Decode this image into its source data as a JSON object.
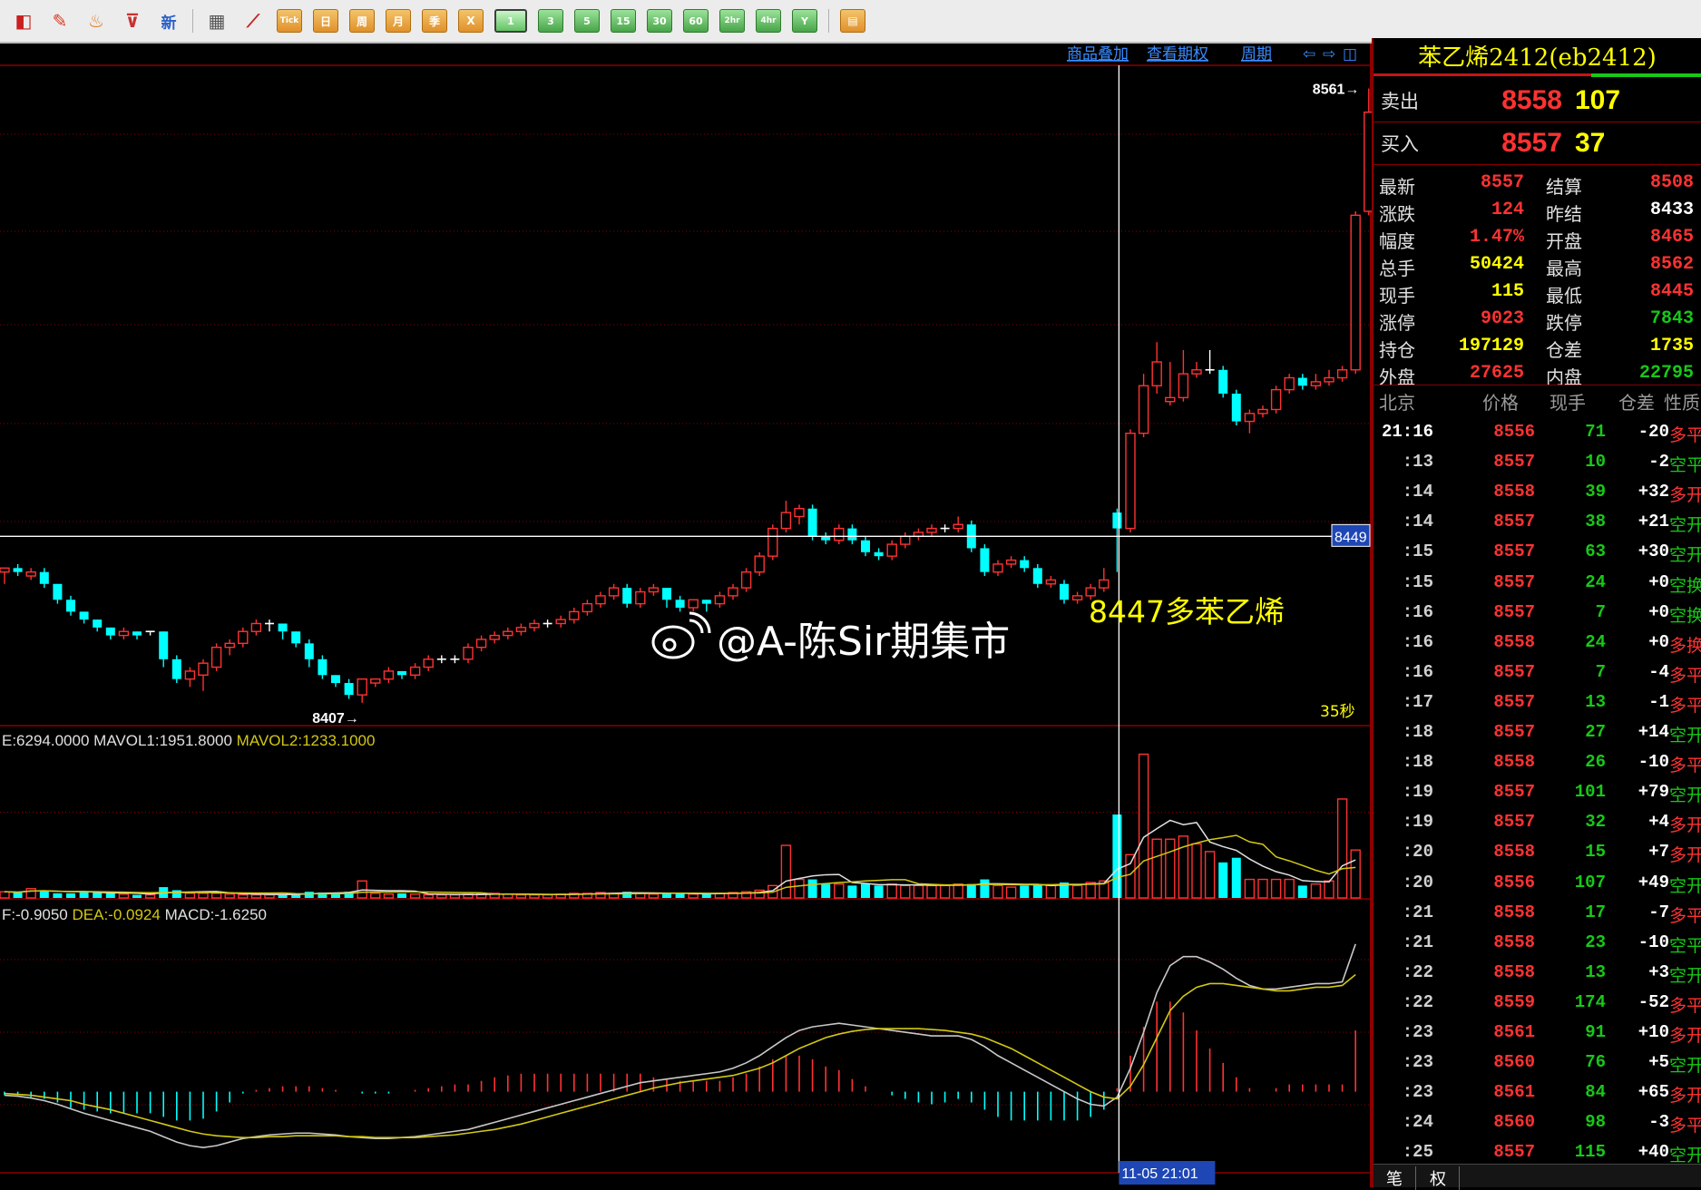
{
  "toolbar": {
    "icons": [
      "window-icon",
      "pencil-icon",
      "bell-icon",
      "filter-icon",
      "new-icon",
      "table-icon",
      "trend-icon"
    ],
    "new_label": "新",
    "periods": [
      "Tick",
      "日",
      "周",
      "月",
      "季",
      "X"
    ],
    "minutes": [
      "1",
      "3",
      "5",
      "15",
      "30",
      "60",
      "2hr",
      "4hr",
      "Y"
    ],
    "selected_minute": "1"
  },
  "chart_header": {
    "links": [
      "商品叠加",
      "查看期权",
      "周期"
    ]
  },
  "instrument": {
    "title": "苯乙烯2412(eb2412)",
    "sell_label": "卖出",
    "sell_price": "8558",
    "sell_vol": "107",
    "buy_label": "买入",
    "buy_price": "8557",
    "buy_vol": "37"
  },
  "stats": [
    {
      "l": "最新",
      "lv": "8557",
      "r": "结算",
      "rv": "8508",
      "rc": "#ff3232"
    },
    {
      "l": "涨跌",
      "lv": "124",
      "r": "昨结",
      "rv": "8433",
      "rc": "#ffffff"
    },
    {
      "l": "幅度",
      "lv": "1.47%",
      "r": "开盘",
      "rv": "8465",
      "rc": "#ff3232"
    },
    {
      "l": "总手",
      "lv": "50424",
      "r": "最高",
      "rv": "8562",
      "rc": "#ff3232",
      "lc": "#ffff00"
    },
    {
      "l": "现手",
      "lv": "115",
      "r": "最低",
      "rv": "8445",
      "rc": "#ff3232",
      "lc": "#ffff00"
    },
    {
      "l": "涨停",
      "lv": "9023",
      "r": "跌停",
      "rv": "7843",
      "rc": "#18c818"
    },
    {
      "l": "持仓",
      "lv": "197129",
      "r": "仓差",
      "rv": "1735",
      "rc": "#ffff00",
      "lc": "#ffff00"
    },
    {
      "l": "外盘",
      "lv": "27625",
      "r": "内盘",
      "rv": "22795",
      "rc": "#18c818"
    }
  ],
  "ticks_header": [
    "北京",
    "价格",
    "现手",
    "仓差",
    "性质"
  ],
  "ticks": [
    {
      "t": "21:16",
      "p": "8556",
      "v": "71",
      "d": "-20",
      "n": "多平"
    },
    {
      "t": ":13",
      "p": "8557",
      "v": "10",
      "d": "-2",
      "n": "空平"
    },
    {
      "t": ":14",
      "p": "8558",
      "v": "39",
      "d": "+32",
      "n": "多开"
    },
    {
      "t": ":14",
      "p": "8557",
      "v": "38",
      "d": "+21",
      "n": "空开"
    },
    {
      "t": ":15",
      "p": "8557",
      "v": "63",
      "d": "+30",
      "n": "空开"
    },
    {
      "t": ":15",
      "p": "8557",
      "v": "24",
      "d": "+0",
      "n": "空换"
    },
    {
      "t": ":16",
      "p": "8557",
      "v": "7",
      "d": "+0",
      "n": "空换"
    },
    {
      "t": ":16",
      "p": "8558",
      "v": "24",
      "d": "+0",
      "n": "多换"
    },
    {
      "t": ":16",
      "p": "8557",
      "v": "7",
      "d": "-4",
      "n": "多平"
    },
    {
      "t": ":17",
      "p": "8557",
      "v": "13",
      "d": "-1",
      "n": "多平"
    },
    {
      "t": ":18",
      "p": "8557",
      "v": "27",
      "d": "+14",
      "n": "空开"
    },
    {
      "t": ":18",
      "p": "8558",
      "v": "26",
      "d": "-10",
      "n": "多平"
    },
    {
      "t": ":19",
      "p": "8557",
      "v": "101",
      "d": "+79",
      "n": "空开"
    },
    {
      "t": ":19",
      "p": "8557",
      "v": "32",
      "d": "+4",
      "n": "多开"
    },
    {
      "t": ":20",
      "p": "8558",
      "v": "15",
      "d": "+7",
      "n": "多开"
    },
    {
      "t": ":20",
      "p": "8556",
      "v": "107",
      "d": "+49",
      "n": "空开"
    },
    {
      "t": ":21",
      "p": "8558",
      "v": "17",
      "d": "-7",
      "n": "多平"
    },
    {
      "t": ":21",
      "p": "8558",
      "v": "23",
      "d": "-10",
      "n": "空平"
    },
    {
      "t": ":22",
      "p": "8558",
      "v": "13",
      "d": "+3",
      "n": "空开"
    },
    {
      "t": ":22",
      "p": "8559",
      "v": "174",
      "d": "-52",
      "n": "多平"
    },
    {
      "t": ":23",
      "p": "8561",
      "v": "91",
      "d": "+10",
      "n": "多开"
    },
    {
      "t": ":23",
      "p": "8560",
      "v": "76",
      "d": "+5",
      "n": "空开"
    },
    {
      "t": ":23",
      "p": "8561",
      "v": "84",
      "d": "+65",
      "n": "多开"
    },
    {
      "t": ":24",
      "p": "8560",
      "v": "98",
      "d": "-3",
      "n": "多平"
    },
    {
      "t": ":25",
      "p": "8557",
      "v": "115",
      "d": "+40",
      "n": "空开"
    }
  ],
  "bottom_tabs": [
    "笔",
    "权"
  ],
  "colors": {
    "up": "#ff3232",
    "down": "#00ffff",
    "bg": "#000000",
    "grid": "#8b0000",
    "dif": "#c8c8c8",
    "dea": "#d2c814",
    "mavol2": "#d2c814"
  },
  "chart_data": {
    "type": "candlestick",
    "price_labels": {
      "high": "8561→",
      "low": "8407→",
      "current": "8449"
    },
    "annotation": "8447多苯乙烯",
    "watermark": "@A-陈Sir期集市",
    "countdown": "35秒",
    "cursor_time": "11-05 21:01",
    "cursor_index": 84,
    "candles": [
      [
        8440,
        8441,
        8437,
        8440
      ],
      [
        8441,
        8440,
        8439,
        8442
      ],
      [
        8439,
        8440,
        8438,
        8441
      ],
      [
        8440,
        8437,
        8436,
        8441
      ],
      [
        8437,
        8433,
        8432,
        8437
      ],
      [
        8433,
        8430,
        8429,
        8434
      ],
      [
        8430,
        8428,
        8427,
        8430
      ],
      [
        8428,
        8426,
        8425,
        8428
      ],
      [
        8426,
        8424,
        8423,
        8426
      ],
      [
        8424,
        8425,
        8423,
        8426
      ],
      [
        8425,
        8424,
        8423,
        8425
      ],
      [
        8425,
        8425,
        8424,
        8425
      ],
      [
        8425,
        8418,
        8416,
        8425
      ],
      [
        8418,
        8413,
        8412,
        8419
      ],
      [
        8413,
        8415,
        8411,
        8416
      ],
      [
        8414,
        8417,
        8410,
        8418
      ],
      [
        8416,
        8421,
        8415,
        8422
      ],
      [
        8421,
        8422,
        8419,
        8423
      ],
      [
        8422,
        8425,
        8421,
        8426
      ],
      [
        8425,
        8427,
        8424,
        8428
      ],
      [
        8427,
        8427,
        8425,
        8428
      ],
      [
        8427,
        8425,
        8423,
        8427
      ],
      [
        8425,
        8422,
        8421,
        8425
      ],
      [
        8422,
        8418,
        8416,
        8423
      ],
      [
        8418,
        8414,
        8413,
        8419
      ],
      [
        8414,
        8412,
        8411,
        8414
      ],
      [
        8412,
        8409,
        8408,
        8413
      ],
      [
        8409,
        8413,
        8407,
        8413
      ],
      [
        8412,
        8413,
        8411,
        8413
      ],
      [
        8413,
        8415,
        8412,
        8416
      ],
      [
        8415,
        8414,
        8413,
        8415
      ],
      [
        8414,
        8416,
        8413,
        8417
      ],
      [
        8416,
        8418,
        8415,
        8419
      ],
      [
        8418,
        8418,
        8417,
        8419
      ],
      [
        8418,
        8418,
        8417,
        8419
      ],
      [
        8418,
        8421,
        8417,
        8422
      ],
      [
        8421,
        8423,
        8420,
        8424
      ],
      [
        8423,
        8424,
        8422,
        8425
      ],
      [
        8424,
        8425,
        8423,
        8426
      ],
      [
        8425,
        8426,
        8424,
        8427
      ],
      [
        8426,
        8427,
        8425,
        8428
      ],
      [
        8427,
        8427,
        8426,
        8428
      ],
      [
        8427,
        8428,
        8426,
        8429
      ],
      [
        8428,
        8430,
        8427,
        8431
      ],
      [
        8430,
        8432,
        8429,
        8433
      ],
      [
        8432,
        8434,
        8431,
        8435
      ],
      [
        8434,
        8436,
        8433,
        8437
      ],
      [
        8436,
        8432,
        8431,
        8437
      ],
      [
        8432,
        8435,
        8431,
        8436
      ],
      [
        8435,
        8436,
        8434,
        8437
      ],
      [
        8436,
        8433,
        8431,
        8436
      ],
      [
        8433,
        8431,
        8430,
        8434
      ],
      [
        8431,
        8433,
        8430,
        8433
      ],
      [
        8433,
        8432,
        8430,
        8433
      ],
      [
        8432,
        8434,
        8431,
        8435
      ],
      [
        8434,
        8436,
        8433,
        8437
      ],
      [
        8436,
        8440,
        8435,
        8441
      ],
      [
        8440,
        8444,
        8439,
        8445
      ],
      [
        8444,
        8451,
        8443,
        8452
      ],
      [
        8451,
        8455,
        8450,
        8458
      ],
      [
        8454,
        8456,
        8452,
        8457
      ],
      [
        8456,
        8449,
        8448,
        8457
      ],
      [
        8449,
        8448,
        8447,
        8450
      ],
      [
        8448,
        8451,
        8447,
        8452
      ],
      [
        8451,
        8448,
        8447,
        8452
      ],
      [
        8448,
        8445,
        8444,
        8449
      ],
      [
        8445,
        8444,
        8443,
        8446
      ],
      [
        8444,
        8447,
        8443,
        8448
      ],
      [
        8447,
        8449,
        8446,
        8450
      ],
      [
        8449,
        8450,
        8448,
        8451
      ],
      [
        8450,
        8451,
        8449,
        8452
      ],
      [
        8451,
        8451,
        8450,
        8452
      ],
      [
        8451,
        8452,
        8450,
        8454
      ],
      [
        8452,
        8446,
        8445,
        8453
      ],
      [
        8446,
        8440,
        8439,
        8447
      ],
      [
        8440,
        8442,
        8439,
        8443
      ],
      [
        8442,
        8443,
        8441,
        8444
      ],
      [
        8443,
        8441,
        8440,
        8444
      ],
      [
        8441,
        8437,
        8436,
        8442
      ],
      [
        8437,
        8438,
        8436,
        8439
      ],
      [
        8437,
        8433,
        8432,
        8438
      ],
      [
        8433,
        8434,
        8432,
        8435
      ],
      [
        8434,
        8436,
        8433,
        8437
      ],
      [
        8436,
        8438,
        8435,
        8441
      ],
      [
        8455,
        8451,
        8440,
        8456
      ],
      [
        8451,
        8475,
        8450,
        8476
      ],
      [
        8475,
        8487,
        8474,
        8490
      ],
      [
        8487,
        8493,
        8485,
        8498
      ],
      [
        8483,
        8484,
        8482,
        8493
      ],
      [
        8484,
        8490,
        8483,
        8496
      ],
      [
        8490,
        8491,
        8489,
        8493
      ],
      [
        8491,
        8491,
        8490,
        8496
      ],
      [
        8491,
        8485,
        8484,
        8492
      ],
      [
        8485,
        8478,
        8477,
        8486
      ],
      [
        8478,
        8480,
        8475,
        8481
      ],
      [
        8480,
        8481,
        8479,
        8482
      ],
      [
        8481,
        8486,
        8480,
        8487
      ],
      [
        8486,
        8489,
        8485,
        8490
      ],
      [
        8489,
        8487,
        8486,
        8490
      ],
      [
        8487,
        8488,
        8486,
        8490
      ],
      [
        8488,
        8489,
        8487,
        8491
      ],
      [
        8489,
        8491,
        8488,
        8492
      ],
      [
        8491,
        8530,
        8490,
        8531
      ],
      [
        8531,
        8556,
        8530,
        8562
      ]
    ],
    "ymin": 8404,
    "ymax": 8566,
    "volume": {
      "label": "E:6294.0000",
      "mavol1_label": "MAVOL1:1951.8000",
      "mavol2_label": "MAVOL2:1233.1000",
      "values": [
        400,
        350,
        600,
        500,
        300,
        300,
        400,
        350,
        300,
        250,
        200,
        200,
        700,
        500,
        300,
        300,
        300,
        250,
        200,
        200,
        200,
        250,
        300,
        400,
        350,
        300,
        400,
        1100,
        300,
        250,
        300,
        250,
        200,
        200,
        200,
        250,
        250,
        300,
        250,
        200,
        200,
        200,
        250,
        300,
        300,
        350,
        300,
        400,
        300,
        250,
        300,
        300,
        250,
        250,
        300,
        350,
        400,
        500,
        800,
        3400,
        1200,
        1200,
        900,
        900,
        800,
        900,
        800,
        900,
        800,
        800,
        800,
        800,
        900,
        900,
        1200,
        800,
        700,
        800,
        900,
        800,
        1000,
        800,
        1000,
        1100,
        5400,
        2800,
        9300,
        3800,
        3800,
        4000,
        3500,
        3000,
        2300,
        2600,
        1200,
        1200,
        1200,
        1200,
        800,
        900,
        1100,
        6400,
        3100
      ],
      "ymax": 9800
    },
    "macd": {
      "label": "F:-0.9050",
      "dea_label": "DEA:-0.0924",
      "macd_label": "MACD:-1.6250",
      "dif": [
        -0.2,
        -0.25,
        -0.35,
        -0.5,
        -0.7,
        -0.95,
        -1.2,
        -1.4,
        -1.6,
        -1.8,
        -2.0,
        -2.2,
        -2.5,
        -2.8,
        -3.0,
        -3.1,
        -3.0,
        -2.8,
        -2.6,
        -2.5,
        -2.4,
        -2.35,
        -2.3,
        -2.3,
        -2.35,
        -2.4,
        -2.5,
        -2.55,
        -2.6,
        -2.6,
        -2.55,
        -2.5,
        -2.4,
        -2.3,
        -2.2,
        -2.1,
        -1.9,
        -1.7,
        -1.5,
        -1.3,
        -1.1,
        -0.9,
        -0.7,
        -0.5,
        -0.3,
        -0.1,
        0.1,
        0.3,
        0.5,
        0.6,
        0.7,
        0.8,
        0.9,
        1.0,
        1.1,
        1.3,
        1.6,
        2.0,
        2.5,
        3.0,
        3.4,
        3.6,
        3.7,
        3.8,
        3.7,
        3.6,
        3.5,
        3.4,
        3.3,
        3.2,
        3.1,
        3.1,
        3.1,
        2.9,
        2.5,
        2.0,
        1.6,
        1.2,
        0.8,
        0.4,
        0.0,
        -0.4,
        -0.7,
        -0.8,
        -0.3,
        1.3,
        3.3,
        5.5,
        7.0,
        7.5,
        7.5,
        7.2,
        6.8,
        6.3,
        5.9,
        5.7,
        5.7,
        5.8,
        5.9,
        6.0,
        6.0,
        6.1,
        8.2
      ],
      "dea": [
        -0.1,
        -0.15,
        -0.2,
        -0.3,
        -0.4,
        -0.5,
        -0.7,
        -0.85,
        -1.0,
        -1.2,
        -1.4,
        -1.6,
        -1.8,
        -2.0,
        -2.2,
        -2.35,
        -2.45,
        -2.5,
        -2.55,
        -2.55,
        -2.5,
        -2.5,
        -2.45,
        -2.45,
        -2.45,
        -2.45,
        -2.5,
        -2.5,
        -2.55,
        -2.55,
        -2.55,
        -2.55,
        -2.5,
        -2.45,
        -2.4,
        -2.3,
        -2.2,
        -2.1,
        -1.95,
        -1.8,
        -1.6,
        -1.4,
        -1.2,
        -1.0,
        -0.8,
        -0.6,
        -0.4,
        -0.2,
        0.0,
        0.2,
        0.35,
        0.5,
        0.6,
        0.7,
        0.8,
        0.9,
        1.1,
        1.3,
        1.6,
        2.0,
        2.4,
        2.7,
        3.0,
        3.2,
        3.35,
        3.45,
        3.5,
        3.5,
        3.5,
        3.5,
        3.45,
        3.4,
        3.3,
        3.2,
        3.0,
        2.7,
        2.4,
        2.0,
        1.6,
        1.2,
        0.8,
        0.4,
        0.0,
        -0.3,
        -0.4,
        0.3,
        1.5,
        3.0,
        4.5,
        5.3,
        5.8,
        6.0,
        6.0,
        5.9,
        5.8,
        5.7,
        5.6,
        5.6,
        5.7,
        5.8,
        5.8,
        5.9,
        6.5
      ],
      "ymin": -4.0,
      "ymax": 9.5
    }
  }
}
